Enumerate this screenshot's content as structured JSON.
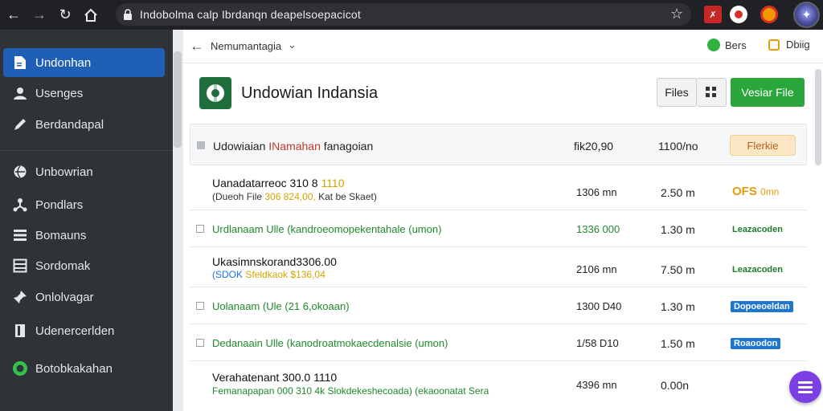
{
  "browser": {
    "url": "Indobolma calp Ibrdanqn deapelsoepacicot",
    "nav": [
      "back-arrow",
      "forward-arrow",
      "reload",
      "home"
    ],
    "extensions": [
      "red-extension",
      "record-extension",
      "orange-extension"
    ]
  },
  "sidebar": {
    "items": [
      {
        "label": "Undonhan",
        "icon": "document-icon",
        "active": true
      },
      {
        "label": "Usenges",
        "icon": "user-icon"
      },
      {
        "label": "Berdandapal",
        "icon": "pen-icon"
      },
      {
        "label": "Unbowrian",
        "icon": "globe-icon"
      },
      {
        "label": "Pondlars",
        "icon": "network-icon"
      },
      {
        "label": "Bomauns",
        "icon": "list-icon"
      },
      {
        "label": "Sordomak",
        "icon": "table-icon"
      },
      {
        "label": "Onlolvagar",
        "icon": "pin-icon"
      },
      {
        "label": "Udenercerlden",
        "icon": "book-icon"
      },
      {
        "label": "Botobkakahan",
        "icon": "green-circle-icon"
      }
    ]
  },
  "topbar": {
    "breadcrumb": "Nemumantagia",
    "status_green": "Bers",
    "status_orange": "Dbiig"
  },
  "header": {
    "title": "Undowian Indansia",
    "files_button": "Files",
    "view_button": "Vesiar File"
  },
  "table": {
    "head": {
      "name": "Udowiaian",
      "name_red": "INamahan",
      "name_tail": "fanagoian",
      "col1": "fik20,90",
      "col2": "1100/no",
      "filter": "Flerkie"
    },
    "rows": [
      {
        "line1": "Uanadatarreoc 310 8",
        "line1_hl": "1110",
        "line2_a": "(Dueoh File",
        "line2_hl": "306 824,00,",
        "line2_b": "Kat be Skaet)",
        "col1": "1306 mn",
        "col2": "2.50 m",
        "tag": "OFS",
        "tag2": "0mn",
        "style": "plain"
      },
      {
        "text": "Urdlanaam  Ulle (kandroeomopekentahale (umon)",
        "col1": "1336 000",
        "col2": "1.30 m",
        "tag": "Leazacoden",
        "style": "green"
      },
      {
        "line1": "Ukasimnskorand3306.00",
        "line2_a": "(SDOK",
        "line2_hl": "Sfeldkaok $136,04",
        "col1": "2106 mn",
        "col2": "7.50 m",
        "tag": "Leazacoden",
        "style": "plain2"
      },
      {
        "text": "Uolanaam  (Ule (21 6,okoaan)",
        "col1": "1300 D40",
        "col2": "1.30 m",
        "tag": "Dopoeoeldan",
        "style": "green-blue"
      },
      {
        "text": "Dedanaain  Ulle (kanodroatmokaecdenalsie (umon)",
        "col1": "1/58 D10",
        "col2": "1.50 m",
        "tag": "Roaoodon",
        "style": "green-blue"
      },
      {
        "line1": "Verahatenant 300.0 1110",
        "line2_a": "Femanapapan 000 310 4k Slokdekeshecoada) (ekaoonatat Sera",
        "col1": "4396 mn",
        "col2": "0.00n",
        "style": "last"
      }
    ]
  },
  "colors": {
    "accent": "#1f5fb5",
    "primary_button": "#2aa63a",
    "sidebar_bg": "#2f3338",
    "fab": "#7b3fe4"
  }
}
